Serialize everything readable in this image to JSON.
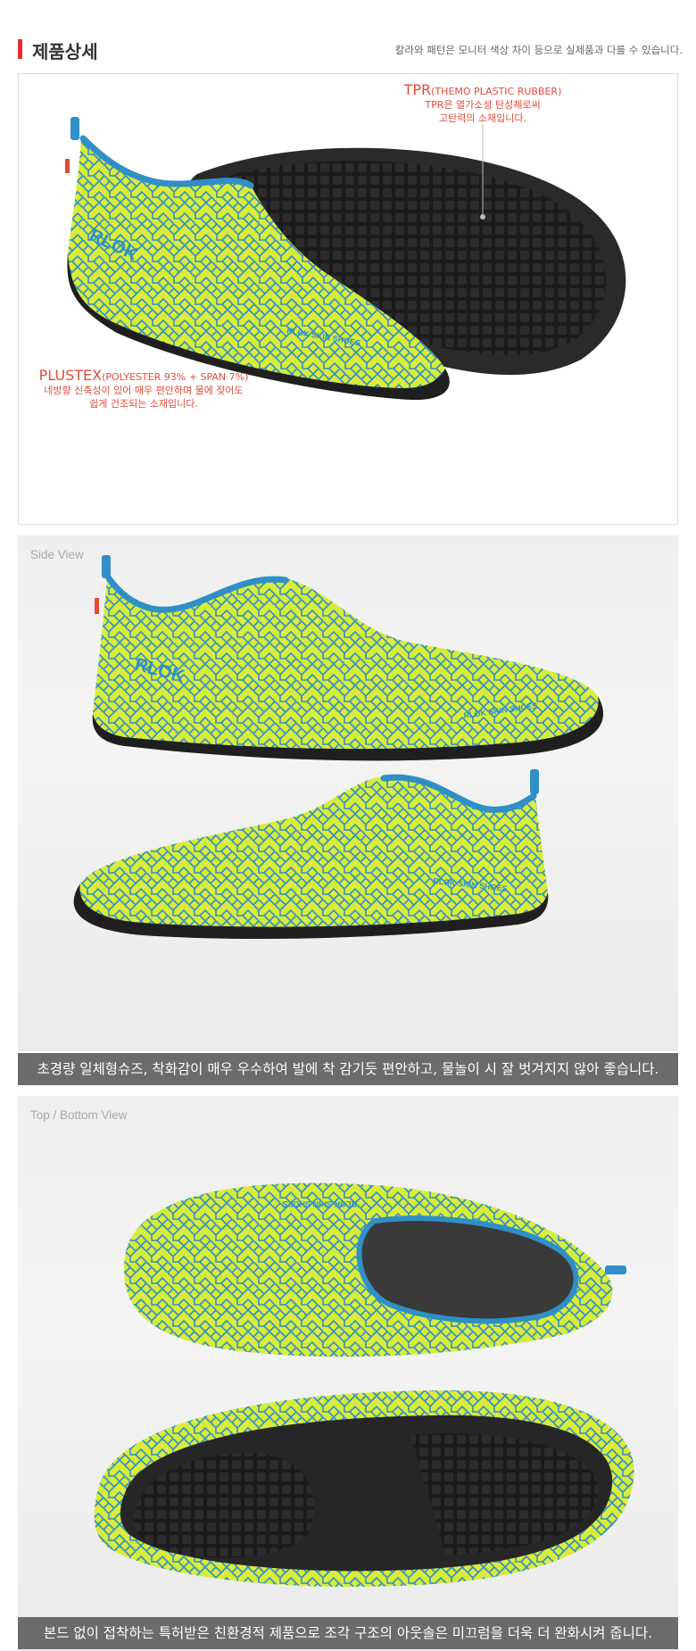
{
  "header": {
    "title": "제품상세",
    "note": "칼라와 패턴은 모니터 색상 차이 등으로 실제품과 다를 수 있습니다."
  },
  "annotations": {
    "tpr": {
      "name": "TPR",
      "detail": "(THEMO PLASTIC RUBBER)",
      "line1": "TPR은 열가소성 탄성체로써",
      "line2": "고탄력의 소재입니다."
    },
    "plustex": {
      "name": "PLUSTEX",
      "detail": "(POLYESTER 93% + SPAN 7%)",
      "line1": "네방향 신축성이 있어 매우 편안하며 물에 젖어도",
      "line2": "쉽게 건조되는 소재입니다."
    }
  },
  "shoe_prints": {
    "logo": "RLOK",
    "side_text": "RLOK SKIN SHOES"
  },
  "views": {
    "side_label": "Side View",
    "top_bottom_label": "Top / Bottom View"
  },
  "captions": {
    "side": "초경량 일체형슈즈, 착화감이 매우 우수하여 발에 착 감기듯 편안하고, 물놀이 시 잘 벗겨지지 않아 좋습니다.",
    "bottom": "본드 없이 접착하는 특허받은 친환경적 제품으로 조각 구조의 아웃솔은 미끄럼을 더욱 더 완화시켜 줍니다."
  },
  "colors": {
    "accent": "#e0302b",
    "shoe_body": "#d9ec3a",
    "shoe_pattern": "#2f8fc6",
    "sole": "#232323",
    "annotation": "#e34a3a",
    "caption_bg": "#6b6b6b"
  }
}
